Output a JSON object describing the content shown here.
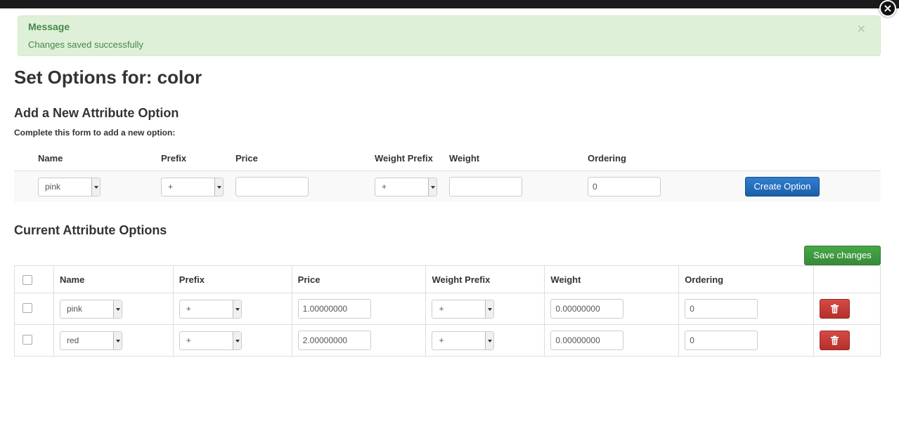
{
  "alert": {
    "title": "Message",
    "text": "Changes saved successfully",
    "close_glyph": "×"
  },
  "close_glyph": "×",
  "page_title": "Set Options for: color",
  "new_option": {
    "section_title": "Add a New Attribute Option",
    "instructions": "Complete this form to add a new option:",
    "headers": {
      "name": "Name",
      "prefix": "Prefix",
      "price": "Price",
      "weight_prefix": "Weight Prefix",
      "weight": "Weight",
      "ordering": "Ordering"
    },
    "name_value": "pink",
    "prefix_value": "+",
    "price_value": "",
    "weight_prefix_value": "+",
    "weight_value": "",
    "ordering_value": "0",
    "create_label": "Create Option"
  },
  "current": {
    "section_title": "Current Attribute Options",
    "save_label": "Save changes",
    "headers": {
      "name": "Name",
      "prefix": "Prefix",
      "price": "Price",
      "weight_prefix": "Weight Prefix",
      "weight": "Weight",
      "ordering": "Ordering"
    },
    "rows": [
      {
        "name": "pink",
        "prefix": "+",
        "price": "1.00000000",
        "weight_prefix": "+",
        "weight": "0.00000000",
        "ordering": "0"
      },
      {
        "name": "red",
        "prefix": "+",
        "price": "2.00000000",
        "weight_prefix": "+",
        "weight": "0.00000000",
        "ordering": "0"
      }
    ]
  },
  "colors": {
    "alert_bg": "#dff0d8",
    "alert_text": "#468847",
    "primary": "#1a5fa8",
    "success": "#398a39",
    "danger": "#b52f2b"
  },
  "icons": {
    "close": "close-icon",
    "delete": "trash-icon",
    "select_arrow": "chevron-down-icon"
  }
}
